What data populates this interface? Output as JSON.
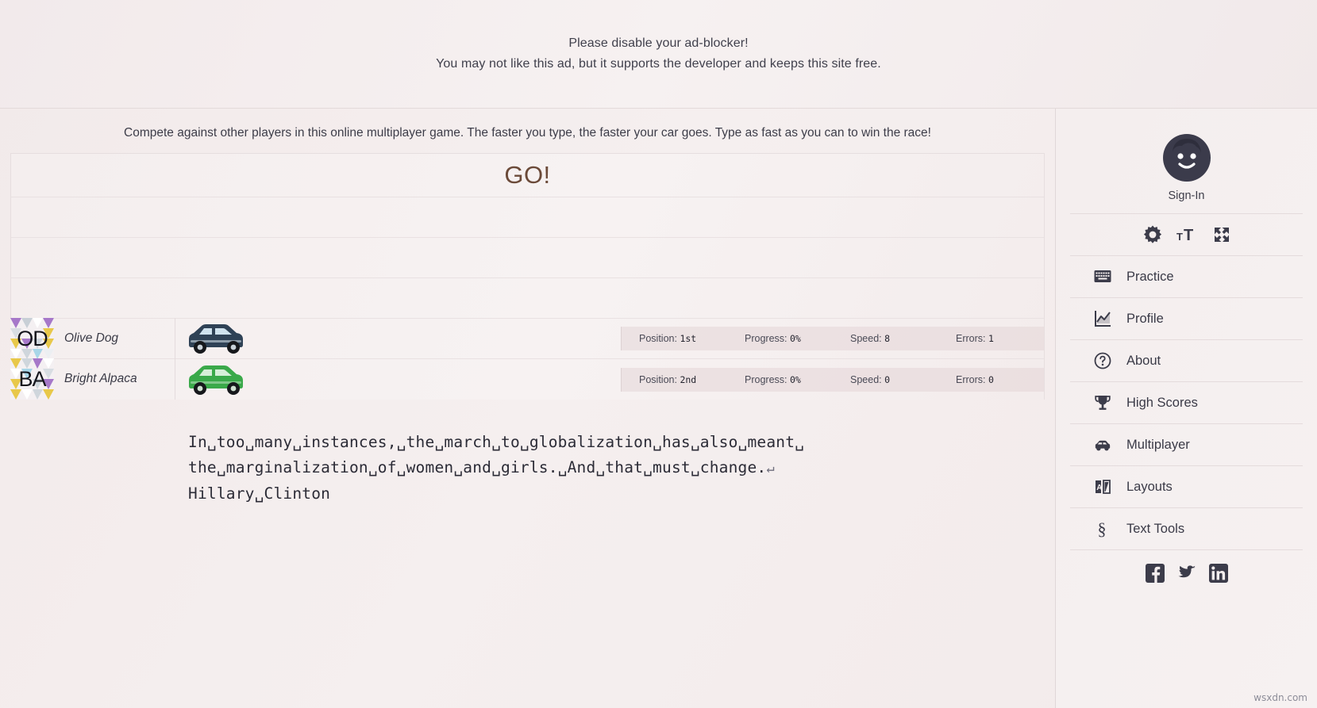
{
  "ad": {
    "line1": "Please disable your ad-blocker!",
    "line2": "You may not like this ad, but it supports the developer and keeps this site free."
  },
  "main": {
    "intro": "Compete against other players in this online multiplayer game. The faster you type, the faster your car goes. Type as fast as you can to win the race!",
    "countdown": "GO!",
    "typing_lines": [
      "In␣too␣many␣instances,␣the␣march␣to␣globalization␣has␣also␣meant␣",
      "the␣marginalization␣of␣women␣and␣girls.␣And␣that␣must␣change.",
      "Hillary␣Clinton"
    ],
    "return_symbol": "↵",
    "quote_text": "In too many instances, the march to globalization has also meant the marginalization of women and girls. And that must change.",
    "quote_author": "Hillary Clinton"
  },
  "race": {
    "stat_labels": {
      "position": "Position:",
      "progress": "Progress:",
      "speed": "Speed:",
      "errors": "Errors:"
    },
    "players": [
      {
        "initials": "OD",
        "name": "Olive Dog",
        "car_color": "#2f4256",
        "car_window": "#cfe2ee",
        "position": "1st",
        "progress": "0%",
        "speed": "8",
        "errors": "1"
      },
      {
        "initials": "BA",
        "name": "Bright Alpaca",
        "car_color": "#3aa94a",
        "car_window": "#d6efd8",
        "position": "2nd",
        "progress": "0%",
        "speed": "0",
        "errors": "0"
      }
    ]
  },
  "sidebar": {
    "signin_label": "Sign-In",
    "tool_icons": [
      {
        "name": "gear-icon"
      },
      {
        "name": "text-size-icon"
      },
      {
        "name": "fullscreen-icon"
      }
    ],
    "items": [
      {
        "label": "Practice",
        "icon": "keyboard-icon"
      },
      {
        "label": "Profile",
        "icon": "chart-line-icon"
      },
      {
        "label": "About",
        "icon": "question-circle-icon"
      },
      {
        "label": "High Scores",
        "icon": "trophy-icon"
      },
      {
        "label": "Multiplayer",
        "icon": "car-icon"
      },
      {
        "label": "Layouts",
        "icon": "layouts-icon"
      },
      {
        "label": "Text Tools",
        "icon": "section-sign-icon"
      }
    ],
    "social": [
      {
        "name": "facebook-icon"
      },
      {
        "name": "twitter-icon"
      },
      {
        "name": "linkedin-icon"
      }
    ]
  },
  "watermark": "wsxdn.com",
  "colors": {
    "accent": "#6b4a39",
    "text": "#3a3a47",
    "background": "#f3ecec",
    "dark": "#3c3c4a"
  }
}
